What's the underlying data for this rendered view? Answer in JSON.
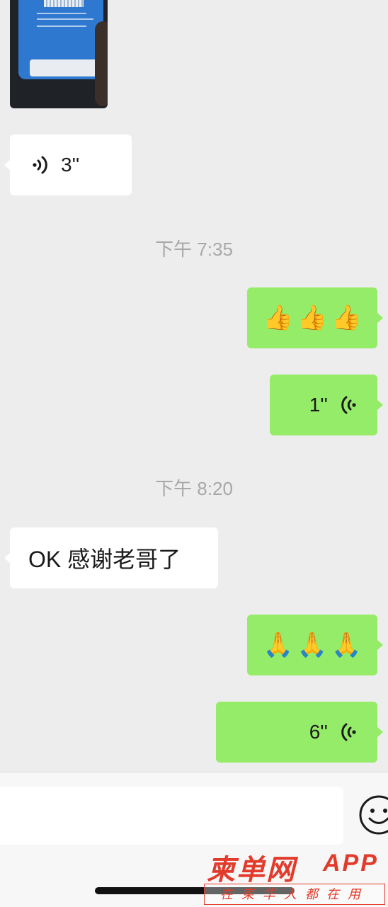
{
  "messages": {
    "voice_in": {
      "duration": "3''"
    },
    "time_1": "下午 7:35",
    "thumbs": {
      "emoji": [
        "👍",
        "👍",
        "👍"
      ]
    },
    "voice_out_1": {
      "duration": "1''"
    },
    "time_2": "下午 8:20",
    "text_in": "OK 感谢老哥了",
    "bow": {
      "emoji": [
        "🙏",
        "🙏",
        "🙏"
      ]
    },
    "voice_out_2": {
      "duration": "6''"
    }
  },
  "input": {
    "placeholder": ""
  },
  "watermark": {
    "logo": "柬单网",
    "app": "APP",
    "slogan": "在柬华人都在用"
  },
  "colors": {
    "incoming": "#ffffff",
    "outgoing": "#95ec69",
    "background": "#ededed",
    "watermark": "#e23b2b"
  },
  "icons": {
    "voice": "voice-wave-icon",
    "emoji": "smiley-icon"
  }
}
